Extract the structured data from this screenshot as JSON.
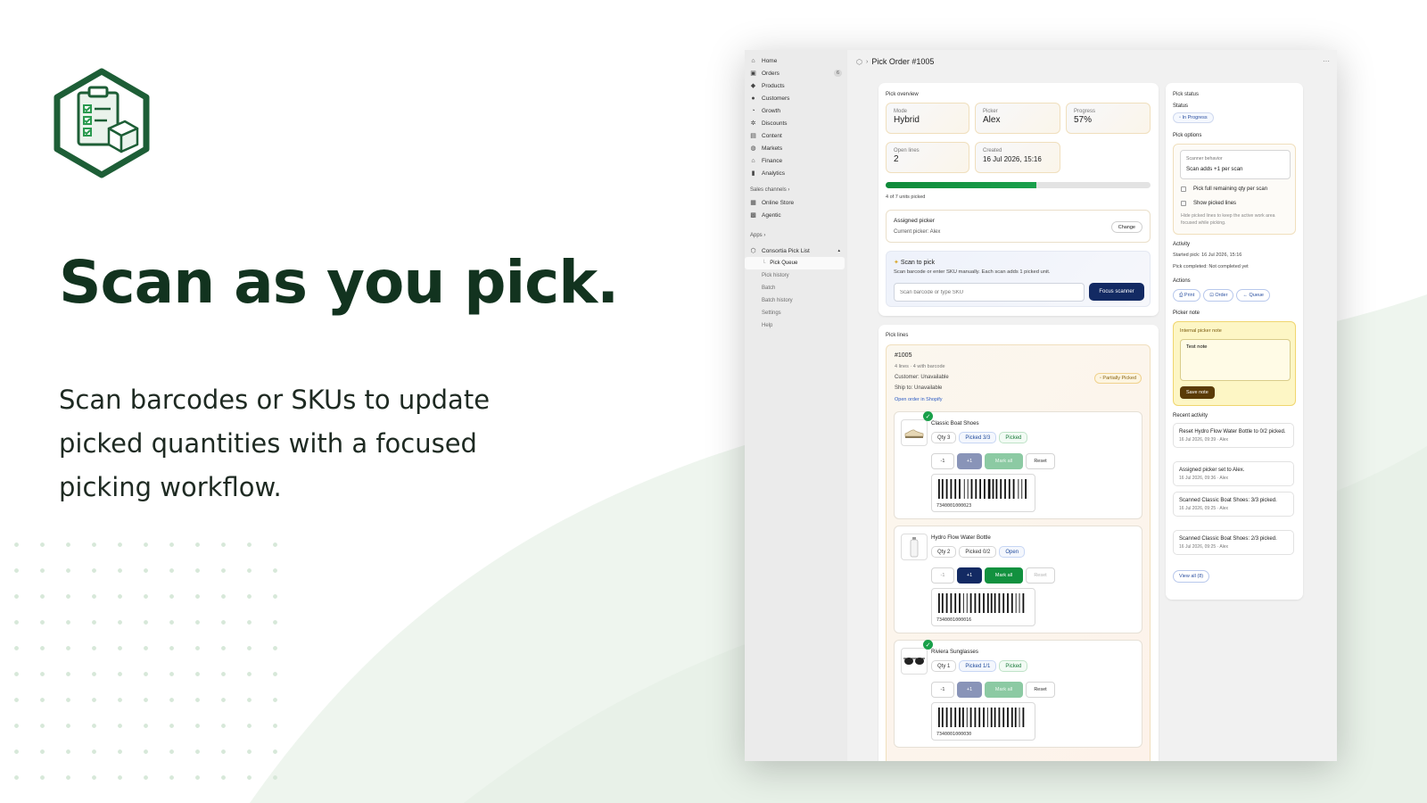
{
  "hero": {
    "headline": "Scan as you pick.",
    "subhead": "Scan barcodes or SKUs to update picked quantities with a focused picking workflow."
  },
  "sidebar": {
    "items": [
      {
        "label": "Home",
        "icon": "home-icon"
      },
      {
        "label": "Orders",
        "icon": "inbox-icon",
        "badge": "6"
      },
      {
        "label": "Products",
        "icon": "tag-icon"
      },
      {
        "label": "Customers",
        "icon": "person-icon"
      },
      {
        "label": "Growth",
        "icon": "growth-icon"
      },
      {
        "label": "Discounts",
        "icon": "discount-icon"
      },
      {
        "label": "Content",
        "icon": "content-icon"
      },
      {
        "label": "Markets",
        "icon": "globe-icon"
      },
      {
        "label": "Finance",
        "icon": "bank-icon"
      },
      {
        "label": "Analytics",
        "icon": "chart-icon"
      }
    ],
    "sales_channels_label": "Sales channels",
    "channels": [
      {
        "label": "Online Store",
        "icon": "store-icon"
      },
      {
        "label": "Agentic",
        "icon": "agentic-icon"
      }
    ],
    "apps_label": "Apps",
    "app_name": "Consortia Pick List",
    "app_subitems": [
      "Pick Queue",
      "Pick history",
      "Batch",
      "Batch history",
      "Settings",
      "Help"
    ]
  },
  "header": {
    "title": "Pick Order #1005",
    "more": "···"
  },
  "overview": {
    "title": "Pick overview",
    "stats": [
      {
        "label": "Mode",
        "value": "Hybrid"
      },
      {
        "label": "Picker",
        "value": "Alex"
      },
      {
        "label": "Progress",
        "value": "57%"
      },
      {
        "label": "Open lines",
        "value": "2"
      },
      {
        "label": "Created",
        "value": "16 Jul 2026, 15:16"
      }
    ],
    "progress_fraction": 0.57,
    "units_text": "4 of 7 units picked",
    "assigned_title": "Assigned picker",
    "assigned_sub": "Current picker: Alex",
    "change_label": "Change",
    "scan_title": "Scan to pick",
    "scan_sub": "Scan barcode or enter SKU manually. Each scan adds 1 picked unit.",
    "scan_placeholder": "Scan barcode or type SKU",
    "focus_label": "Focus scanner"
  },
  "pick_lines": {
    "title": "Pick lines",
    "order_no": "#1005",
    "order_meta": "4 lines · 4 with barcode",
    "customer": "Customer: Unavailable",
    "ship_to": "Ship to: Unavailable",
    "status_badge": "◦ Partially Picked",
    "open_link": "Open order in Shopify",
    "items": [
      {
        "name": "Classic Boat Shoes",
        "qty": "Qty 3",
        "picked": "Picked 3/3",
        "status": "Picked",
        "barcode": "7340001000023",
        "done": true
      },
      {
        "name": "Hydro Flow Water Bottle",
        "qty": "Qty 2",
        "picked": "Picked 0/2",
        "status": "Open",
        "barcode": "7340001000016",
        "done": false
      },
      {
        "name": "Riviera Sunglasses",
        "qty": "Qty 1",
        "picked": "Picked 1/1",
        "status": "Picked",
        "barcode": "7340001000030",
        "done": true
      }
    ],
    "buttons": {
      "minus": "-1",
      "plus": "+1",
      "mark": "Mark all",
      "reset": "Reset"
    }
  },
  "status_panel": {
    "title": "Pick status",
    "status_label": "Status",
    "status_value": "◦ In Progress",
    "options_label": "Pick options",
    "scanner_label": "Scanner behavior",
    "scanner_value": "Scan adds +1 per scan",
    "opt1": "Pick full remaining qty per scan",
    "opt2": "Show picked lines",
    "opt2_help": "Hide picked lines to keep the active work area focused while picking.",
    "activity_label": "Activity",
    "started": "Started pick: 16 Jul 2026, 15:16",
    "completed": "Pick completed: Not completed yet",
    "actions_label": "Actions",
    "actions": [
      "⎙ Print",
      "⊡ Order",
      "← Queue"
    ],
    "note_label": "Picker note",
    "note_title": "Internal picker note",
    "note_text": "Test note",
    "save_note": "Save note",
    "recent_label": "Recent activity",
    "recent": [
      {
        "text": "Reset Hydro Flow Water Bottle to 0/2 picked.",
        "meta": "16 Jul 2026, 09:39 · Alex"
      },
      {
        "text": "Assigned picker set to Alex.",
        "meta": "16 Jul 2026, 09:36 · Alex"
      },
      {
        "text": "Scanned Classic Boat Shoes: 3/3 picked.",
        "meta": "16 Jul 2026, 09:25 · Alex"
      },
      {
        "text": "Scanned Classic Boat Shoes: 2/3 picked.",
        "meta": "16 Jul 2026, 09:25 · Alex"
      }
    ],
    "view_all": "View all (8)"
  },
  "colors": {
    "brand_green": "#12331f",
    "accent_blue": "#132a63",
    "success_green": "#12913f"
  }
}
